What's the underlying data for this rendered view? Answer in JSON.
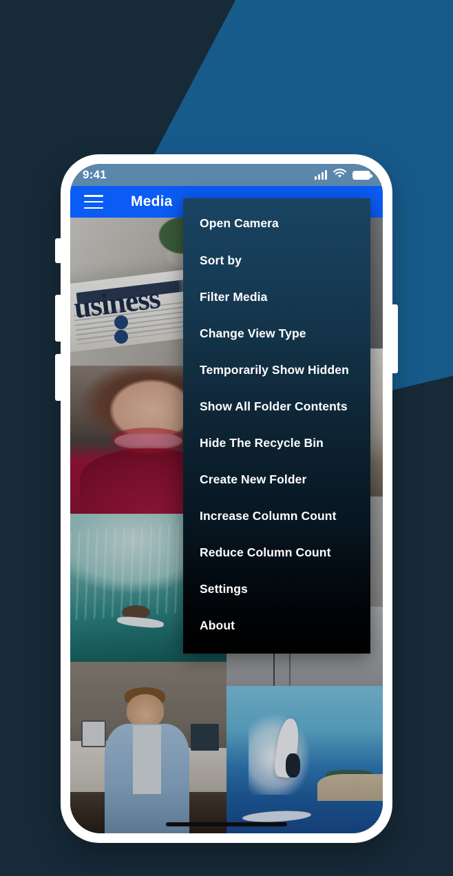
{
  "background": {
    "navy": "#172a38",
    "blue": "#175b8b"
  },
  "phone": {
    "statusbar": {
      "time": "9:41",
      "icons": [
        "signal-bars-icon",
        "wifi-icon",
        "battery-icon"
      ],
      "bg_color": "#5b87ab"
    },
    "appbar": {
      "menu_icon": "hamburger-menu-icon",
      "title": "Media",
      "bg_color": "#0a5cf5"
    },
    "home_indicator": "home-indicator"
  },
  "overflow_menu": {
    "items": [
      {
        "label": "Open Camera"
      },
      {
        "label": "Sort by"
      },
      {
        "label": "Filter Media"
      },
      {
        "label": "Change View Type"
      },
      {
        "label": "Temporarily Show Hidden"
      },
      {
        "label": "Show All Folder Contents"
      },
      {
        "label": "Hide The Recycle Bin"
      },
      {
        "label": "Create New Folder"
      },
      {
        "label": "Increase Column Count"
      },
      {
        "label": "Reduce Column Count"
      },
      {
        "label": "Settings"
      },
      {
        "label": "About"
      }
    ]
  },
  "gallery": {
    "left_column": [
      {
        "name": "photo-business-newspaper",
        "caption": "usiness"
      },
      {
        "name": "photo-smiling-woman-red-sweater"
      },
      {
        "name": "photo-surfer-in-wave"
      },
      {
        "name": "photo-man-in-office"
      }
    ],
    "right_column": [
      {
        "name": "photo-gray-wall"
      },
      {
        "name": "photo-bedroom-interior"
      },
      {
        "name": "photo-concrete-wall"
      },
      {
        "name": "photo-pavement-path"
      },
      {
        "name": "photo-surfer-aerial"
      }
    ]
  }
}
